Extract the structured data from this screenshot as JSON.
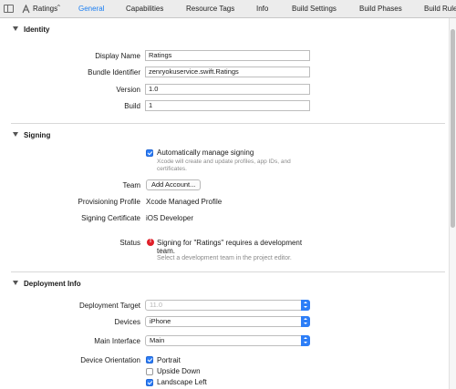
{
  "topbar": {
    "target": "Ratings",
    "tabs": [
      "General",
      "Capabilities",
      "Resource Tags",
      "Info",
      "Build Settings",
      "Build Phases",
      "Build Rule"
    ],
    "active_tab": "General",
    "accent": "#1a7ef2"
  },
  "identity": {
    "title": "Identity",
    "display_name_label": "Display Name",
    "display_name": "Ratings",
    "bundle_id_label": "Bundle Identifier",
    "bundle_id": "zenryokuservice.swift.Ratings",
    "version_label": "Version",
    "version": "1.0",
    "build_label": "Build",
    "build": "1"
  },
  "signing": {
    "title": "Signing",
    "auto_manage_label": "Automatically manage signing",
    "auto_manage_checked": true,
    "auto_hint_line1": "Xcode will create and update profiles, app IDs, and",
    "auto_hint_line2": "certificates.",
    "team_label": "Team",
    "team_button": "Add Account...",
    "profile_label": "Provisioning Profile",
    "profile_value": "Xcode Managed Profile",
    "cert_label": "Signing Certificate",
    "cert_value": "iOS Developer",
    "status_label": "Status",
    "status_line1": "Signing for \"Ratings\" requires a development",
    "status_line2": "team.",
    "status_hint": "Select a development team in the project editor.",
    "error_color": "#e0202a"
  },
  "deployment": {
    "title": "Deployment Info",
    "target_label": "Deployment Target",
    "target_value": "11.0",
    "devices_label": "Devices",
    "devices_value": "iPhone",
    "main_interface_label": "Main Interface",
    "main_interface_value": "Main",
    "orientation_label": "Device Orientation",
    "orientations": [
      {
        "label": "Portrait",
        "checked": true
      },
      {
        "label": "Upside Down",
        "checked": false
      },
      {
        "label": "Landscape Left",
        "checked": true
      }
    ]
  }
}
